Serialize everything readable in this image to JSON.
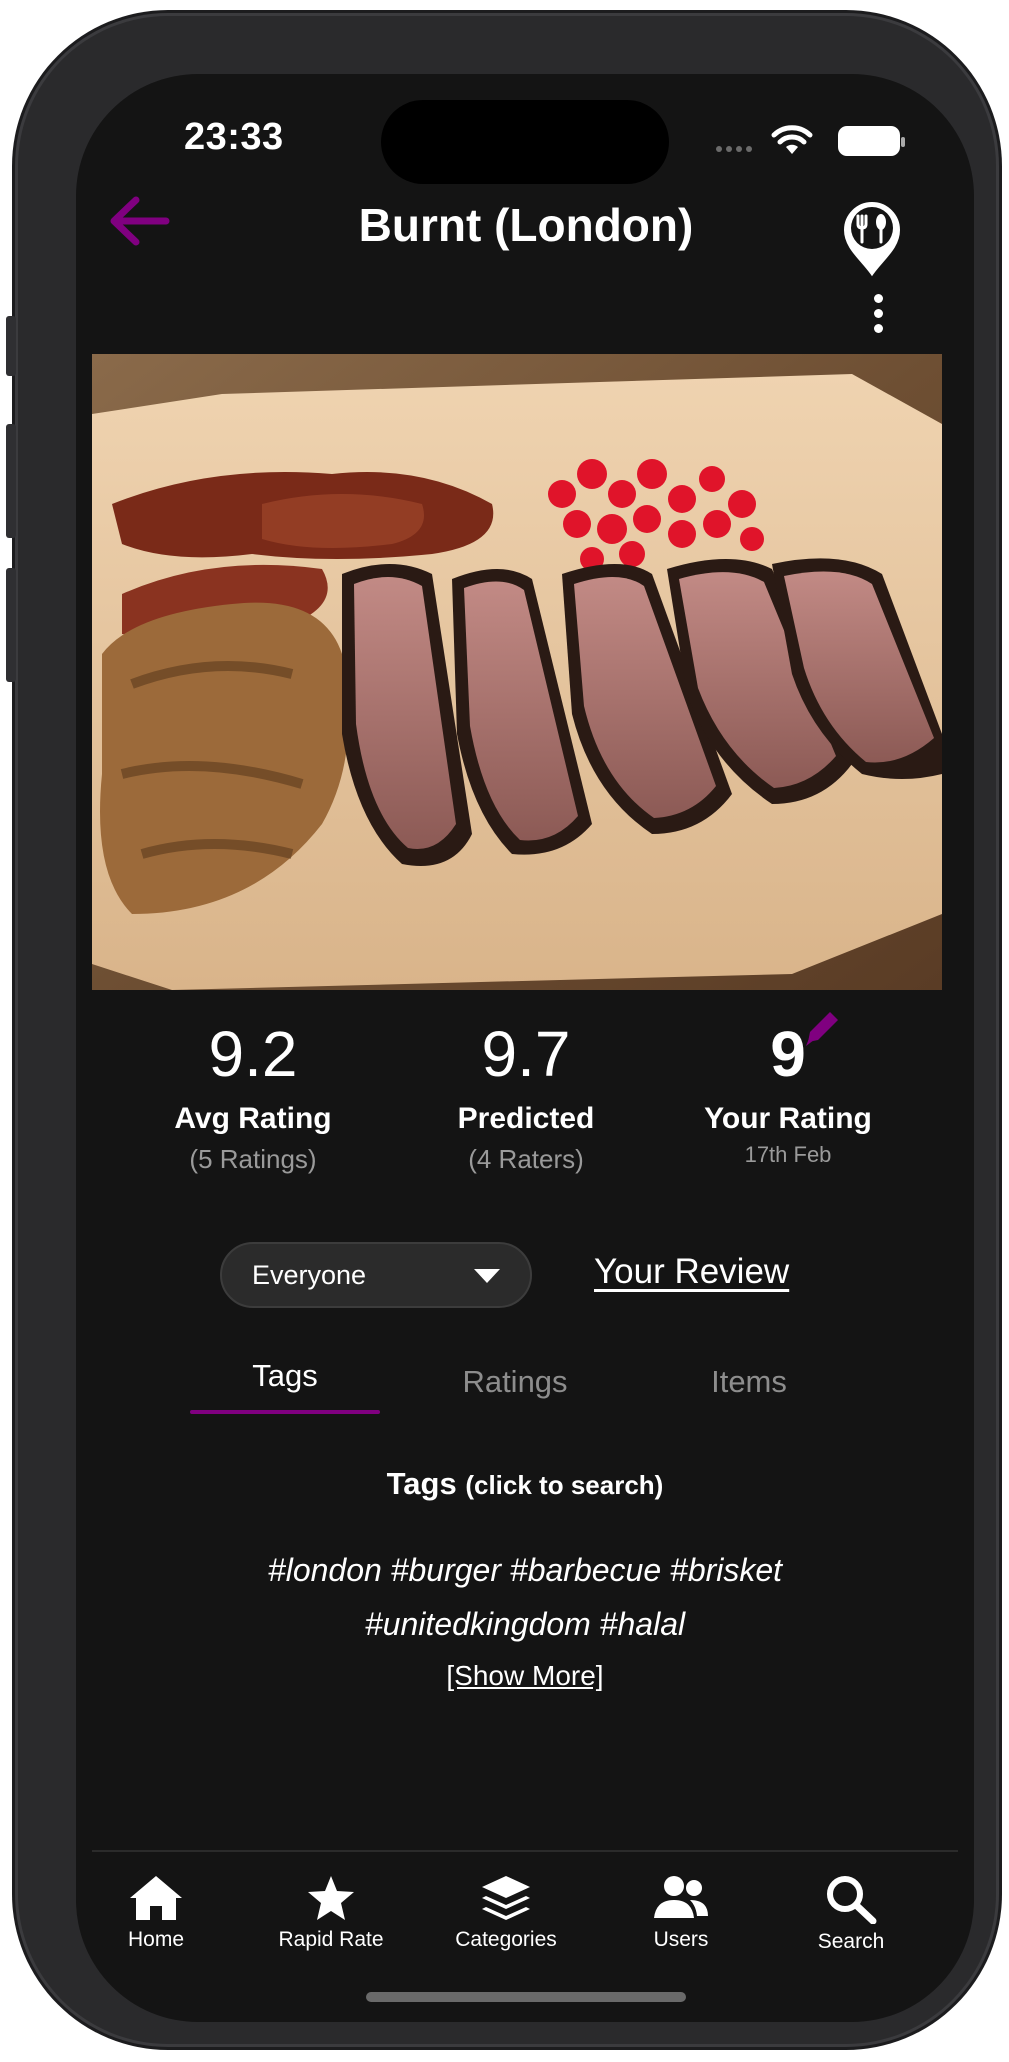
{
  "status_bar": {
    "time": "23:33"
  },
  "header": {
    "title": "Burnt (London)"
  },
  "ratings": [
    {
      "value": "9.2",
      "label": "Avg Rating",
      "sub": "(5 Ratings)"
    },
    {
      "value": "9.7",
      "label": "Predicted",
      "sub": "(4 Raters)"
    },
    {
      "value": "9",
      "label": "Your Rating",
      "sub": "17th Feb"
    }
  ],
  "filter": {
    "selected": "Everyone"
  },
  "review_link": "Your Review",
  "tabs": [
    {
      "label": "Tags",
      "active": true
    },
    {
      "label": "Ratings",
      "active": false
    },
    {
      "label": "Items",
      "active": false
    }
  ],
  "tags_section": {
    "heading": "Tags",
    "hint": "(click to search)",
    "tags": [
      "#london",
      "#burger",
      "#barbecue",
      "#brisket",
      "#unitedkingdom",
      "#halal"
    ],
    "show_more": "[Show More]"
  },
  "bottom_nav": [
    {
      "label": "Home",
      "icon": "home-icon"
    },
    {
      "label": "Rapid Rate",
      "icon": "star-icon"
    },
    {
      "label": "Categories",
      "icon": "layers-icon"
    },
    {
      "label": "Users",
      "icon": "users-icon"
    },
    {
      "label": "Search",
      "icon": "search-icon"
    }
  ],
  "colors": {
    "accent": "#800080",
    "background": "#141414",
    "text": "#ffffff",
    "muted": "#9a9a9a"
  }
}
